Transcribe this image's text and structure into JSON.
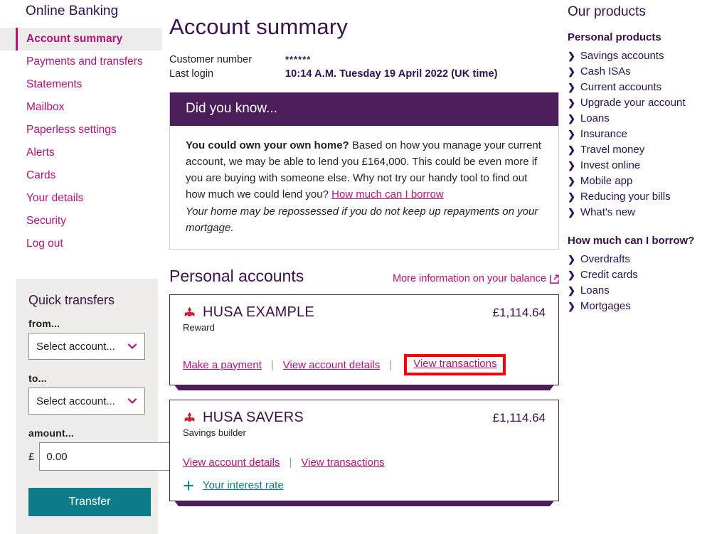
{
  "sidebar": {
    "brand": "Online Banking",
    "items": [
      {
        "label": "Account summary",
        "active": true
      },
      {
        "label": "Payments and transfers",
        "active": false
      },
      {
        "label": "Statements",
        "active": false
      },
      {
        "label": "Mailbox",
        "active": false
      },
      {
        "label": "Paperless settings",
        "active": false
      },
      {
        "label": "Alerts",
        "active": false
      },
      {
        "label": "Cards",
        "active": false
      },
      {
        "label": "Your details",
        "active": false
      },
      {
        "label": "Security",
        "active": false
      },
      {
        "label": "Log out",
        "active": false
      }
    ],
    "quick_transfers": {
      "title": "Quick transfers",
      "from_label": "from...",
      "from_value": "Select account...",
      "to_label": "to...",
      "to_value": "Select account...",
      "amount_label": "amount...",
      "currency_symbol": "£",
      "amount_value": "0.00",
      "transfer_button": "Transfer"
    }
  },
  "main": {
    "page_title": "Account summary",
    "meta": {
      "customer_number_label": "Customer number",
      "customer_number_value": "******",
      "last_login_label": "Last login",
      "last_login_value": "10:14 A.M. Tuesday 19 April 2022 (UK time)"
    },
    "did_you_know": {
      "heading": "Did you know...",
      "bold_lead": "You could own your own home?",
      "body": " Based on how you manage your current account, we may be able to lend you £164,000. This could be even more if you are buying with someone else. Why not try our handy tool to find out how much we could lend you? ",
      "link_text": "How much can I borrow",
      "disclaimer": "Your home may be repossessed if you do not keep up repayments on your mortgage."
    },
    "personal_accounts": {
      "title": "Personal accounts",
      "more_info_link": "More information on your balance",
      "accounts": [
        {
          "name": "HUSA EXAMPLE",
          "type": "Reward",
          "balance": "£1,114.64",
          "links": [
            "Make a payment",
            "View account details",
            "View transactions"
          ],
          "highlighted_link": "View transactions"
        },
        {
          "name": "HUSA SAVERS",
          "type": "Savings builder",
          "balance": "£1,114.64",
          "links": [
            "View account details",
            "View transactions"
          ],
          "interest_rate_link": "Your interest rate"
        }
      ]
    }
  },
  "right": {
    "title": "Our products",
    "groups": [
      {
        "heading": "Personal products",
        "items": [
          "Savings accounts",
          "Cash ISAs",
          "Current accounts",
          "Upgrade your account",
          "Loans",
          "Insurance",
          "Travel money",
          "Invest online",
          "Mobile app",
          "Reducing your bills",
          "What's new"
        ]
      },
      {
        "heading": "How much can I borrow?",
        "items": [
          "Overdrafts",
          "Credit cards",
          "Loans",
          "Mortgages"
        ]
      }
    ]
  },
  "colors": {
    "brand_magenta": "#b2127f",
    "brand_purple": "#3b1049",
    "banner_purple": "#4b1e5a",
    "teal": "#0c7b8a",
    "panel_grey": "#eeece8",
    "highlight_red": "#ff0000",
    "recycle_red": "#c8102e"
  }
}
